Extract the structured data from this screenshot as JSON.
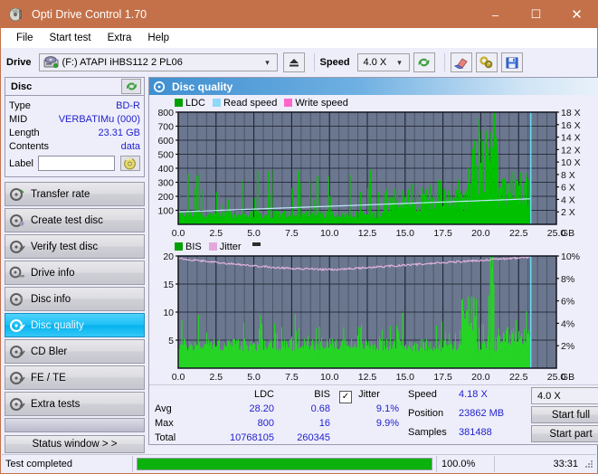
{
  "window": {
    "title": "Opti Drive Control 1.70",
    "title_icon": "disc-icon",
    "minimize": "–",
    "maximize": "☐",
    "close": "✕"
  },
  "menu": [
    "File",
    "Start test",
    "Extra",
    "Help"
  ],
  "toolbar": {
    "drive_label": "Drive",
    "drive_value": "(F:)  ATAPI iHBS112  2 PL06",
    "eject_icon": "eject-icon",
    "speed_label": "Speed",
    "speed_value": "4.0 X",
    "refresh_icon": "refresh-icon",
    "erase_icon": "eraser-icon",
    "tools_icon": "tools-icon",
    "save_icon": "save-icon"
  },
  "disc_panel": {
    "title": "Disc",
    "refresh_icon": "refresh-icon",
    "rows": [
      {
        "key": "Type",
        "value": "BD-R"
      },
      {
        "key": "MID",
        "value": "VERBATIMu (000)"
      },
      {
        "key": "Length",
        "value": "23.31 GB"
      },
      {
        "key": "Contents",
        "value": "data"
      }
    ],
    "label_key": "Label",
    "label_value": "",
    "label_placeholder": "",
    "label_button_icon": "disc-icon"
  },
  "nav": {
    "items": [
      {
        "label": "Transfer rate",
        "icon": "disc-icon",
        "active": false
      },
      {
        "label": "Create test disc",
        "icon": "disc-write-icon",
        "active": false
      },
      {
        "label": "Verify test disc",
        "icon": "disc-check-icon",
        "active": false
      },
      {
        "label": "Drive info",
        "icon": "drive-icon",
        "active": false
      },
      {
        "label": "Disc info",
        "icon": "disc-info-icon",
        "active": false
      },
      {
        "label": "Disc quality",
        "icon": "disc-quality-icon",
        "active": true
      },
      {
        "label": "CD Bler",
        "icon": "disc-icon",
        "active": false
      },
      {
        "label": "FE / TE",
        "icon": "disc-icon",
        "active": false
      },
      {
        "label": "Extra tests",
        "icon": "disc-icon",
        "active": false
      }
    ],
    "status_window": "Status window > >"
  },
  "panel": {
    "title": "Disc quality",
    "icon": "disc-quality-icon"
  },
  "chart_data": [
    {
      "type": "area",
      "name": "ldc-chart",
      "title": "",
      "xlabel": "GB",
      "ylabel": "",
      "xlim": [
        0,
        25
      ],
      "ylim": [
        0,
        800
      ],
      "y2lim": [
        0,
        18
      ],
      "xticks": [
        "0.0",
        "2.5",
        "5.0",
        "7.5",
        "10.0",
        "12.5",
        "15.0",
        "17.5",
        "20.0",
        "22.5",
        "25.0"
      ],
      "yticks": [
        100,
        200,
        300,
        400,
        500,
        600,
        700,
        800
      ],
      "y2ticks": [
        "2 X",
        "4 X",
        "6 X",
        "8 X",
        "10 X",
        "12 X",
        "14 X",
        "16 X",
        "18 X"
      ],
      "xunit": "GB",
      "grid": true,
      "legend": [
        {
          "name": "LDC",
          "color": "#00a000"
        },
        {
          "name": "Read speed",
          "color": "#8fd8f8"
        },
        {
          "name": "Write speed",
          "color": "#ff66cc"
        }
      ],
      "data_end_gb": 23.31,
      "ldc_baseline": 70,
      "ldc_max": 800,
      "ldc_avg": 28.2,
      "read_speed_start_x": 2.0,
      "read_speed_end_x": 4.1
    },
    {
      "type": "area",
      "name": "bis-jitter-chart",
      "title": "",
      "xlabel": "GB",
      "ylabel": "",
      "xlim": [
        0,
        25
      ],
      "ylim": [
        0,
        20
      ],
      "y2lim": [
        0,
        10
      ],
      "xticks": [
        "0.0",
        "2.5",
        "5.0",
        "7.5",
        "10.0",
        "12.5",
        "15.0",
        "17.5",
        "20.0",
        "22.5",
        "25.0"
      ],
      "yticks": [
        5,
        10,
        15,
        20
      ],
      "y2ticks": [
        "2%",
        "4%",
        "6%",
        "8%",
        "10%"
      ],
      "xunit": "GB",
      "grid": true,
      "legend": [
        {
          "name": "BIS",
          "color": "#00a000"
        },
        {
          "name": "Jitter",
          "color": "#e3a8dc"
        }
      ],
      "data_end_gb": 23.31,
      "bis_avg": 0.68,
      "bis_max": 16,
      "jitter_start_pct": 9.8,
      "jitter_min_pct": 8.8,
      "jitter_end_pct": 9.9
    }
  ],
  "stats": {
    "col_headers": [
      "LDC",
      "BIS"
    ],
    "rows": [
      {
        "label": "Avg",
        "ldc": "28.20",
        "bis": "0.68",
        "jitter": "9.1%"
      },
      {
        "label": "Max",
        "ldc": "800",
        "bis": "16",
        "jitter": "9.9%"
      },
      {
        "label": "Total",
        "ldc": "10768105",
        "bis": "260345",
        "jitter": ""
      }
    ],
    "jitter_label": "Jitter",
    "jitter_checked": "✓",
    "speed_label": "Speed",
    "speed_value": "4.18 X",
    "position_label": "Position",
    "position_value": "23862 MB",
    "samples_label": "Samples",
    "samples_value": "381488",
    "speed_select": "4.0 X",
    "start_full": "Start full",
    "start_part": "Start part"
  },
  "statusbar": {
    "text": "Test completed",
    "progress": 100,
    "percent": "100.0%",
    "time": "33:31"
  }
}
